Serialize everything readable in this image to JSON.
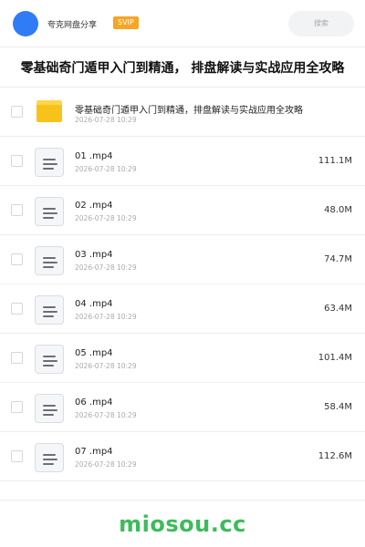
{
  "header": {
    "brand": "夸克网盘分享",
    "badge": "SVIP",
    "search_placeholder": "搜索"
  },
  "title": "零基础奇门遁甲入门到精通， 排盘解读与实战应用全攻略",
  "folder": {
    "name": "零基础奇门遁甲入门到精通，排盘解读与实战应用全攻略",
    "date": "2026-07-28 10:29",
    "icon": "folder-icon"
  },
  "files": [
    {
      "name": "01 .mp4",
      "date": "2026-07-28 10:29",
      "size": "111.1M"
    },
    {
      "name": "02 .mp4",
      "date": "2026-07-28 10:29",
      "size": "48.0M"
    },
    {
      "name": "03 .mp4",
      "date": "2026-07-28 10:29",
      "size": "74.7M"
    },
    {
      "name": "04 .mp4",
      "date": "2026-07-28 10:29",
      "size": "63.4M"
    },
    {
      "name": "05 .mp4",
      "date": "2026-07-28 10:29",
      "size": "101.4M"
    },
    {
      "name": "06 .mp4",
      "date": "2026-07-28 10:29",
      "size": "58.4M"
    },
    {
      "name": "07 .mp4",
      "date": "2026-07-28 10:29",
      "size": "112.6M"
    }
  ],
  "watermark": "miosou.cc",
  "colors": {
    "accent": "#2f7cf6",
    "svip": "#f5a623",
    "folder": "#f7c21a",
    "watermark": "#3dbb5b"
  }
}
